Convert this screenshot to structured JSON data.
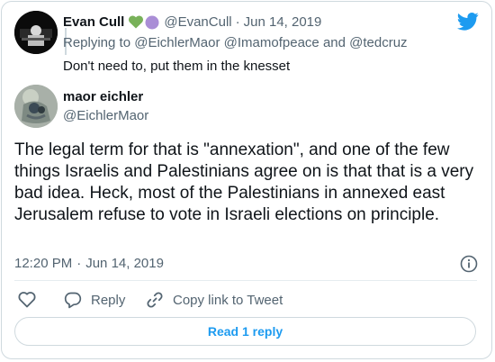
{
  "quoted": {
    "name": "Evan Cull",
    "handle": "@EvanCull",
    "separator": "·",
    "date": "Jun 14, 2019",
    "replying_prefix": "Replying to",
    "reply_handles": [
      "@EichlerMaor",
      "@Imamofpeace",
      "@tedcruz"
    ],
    "reply_and": "and",
    "text": "Don't need to, put them in the knesset",
    "heart_colors": [
      "#78b159",
      "#aa8ed6"
    ]
  },
  "tweet": {
    "name": "maor eichler",
    "handle": "@EichlerMaor",
    "text": "The legal term for that is \"annexation\", and one of the few things Israelis and Palestinians agree on is that that is a very bad idea. Heck, most of the Palestinians in annexed east Jerusalem refuse to vote in Israeli elections on principle.",
    "time": "12:20 PM",
    "separator": "·",
    "date": "Jun 14, 2019"
  },
  "actions": {
    "reply_label": "Reply",
    "copy_label": "Copy link to Tweet"
  },
  "read_reply_label": "Read 1 reply",
  "colors": {
    "twitter_blue": "#1d9bf0",
    "text": "#0f1419",
    "secondary": "#536471"
  }
}
